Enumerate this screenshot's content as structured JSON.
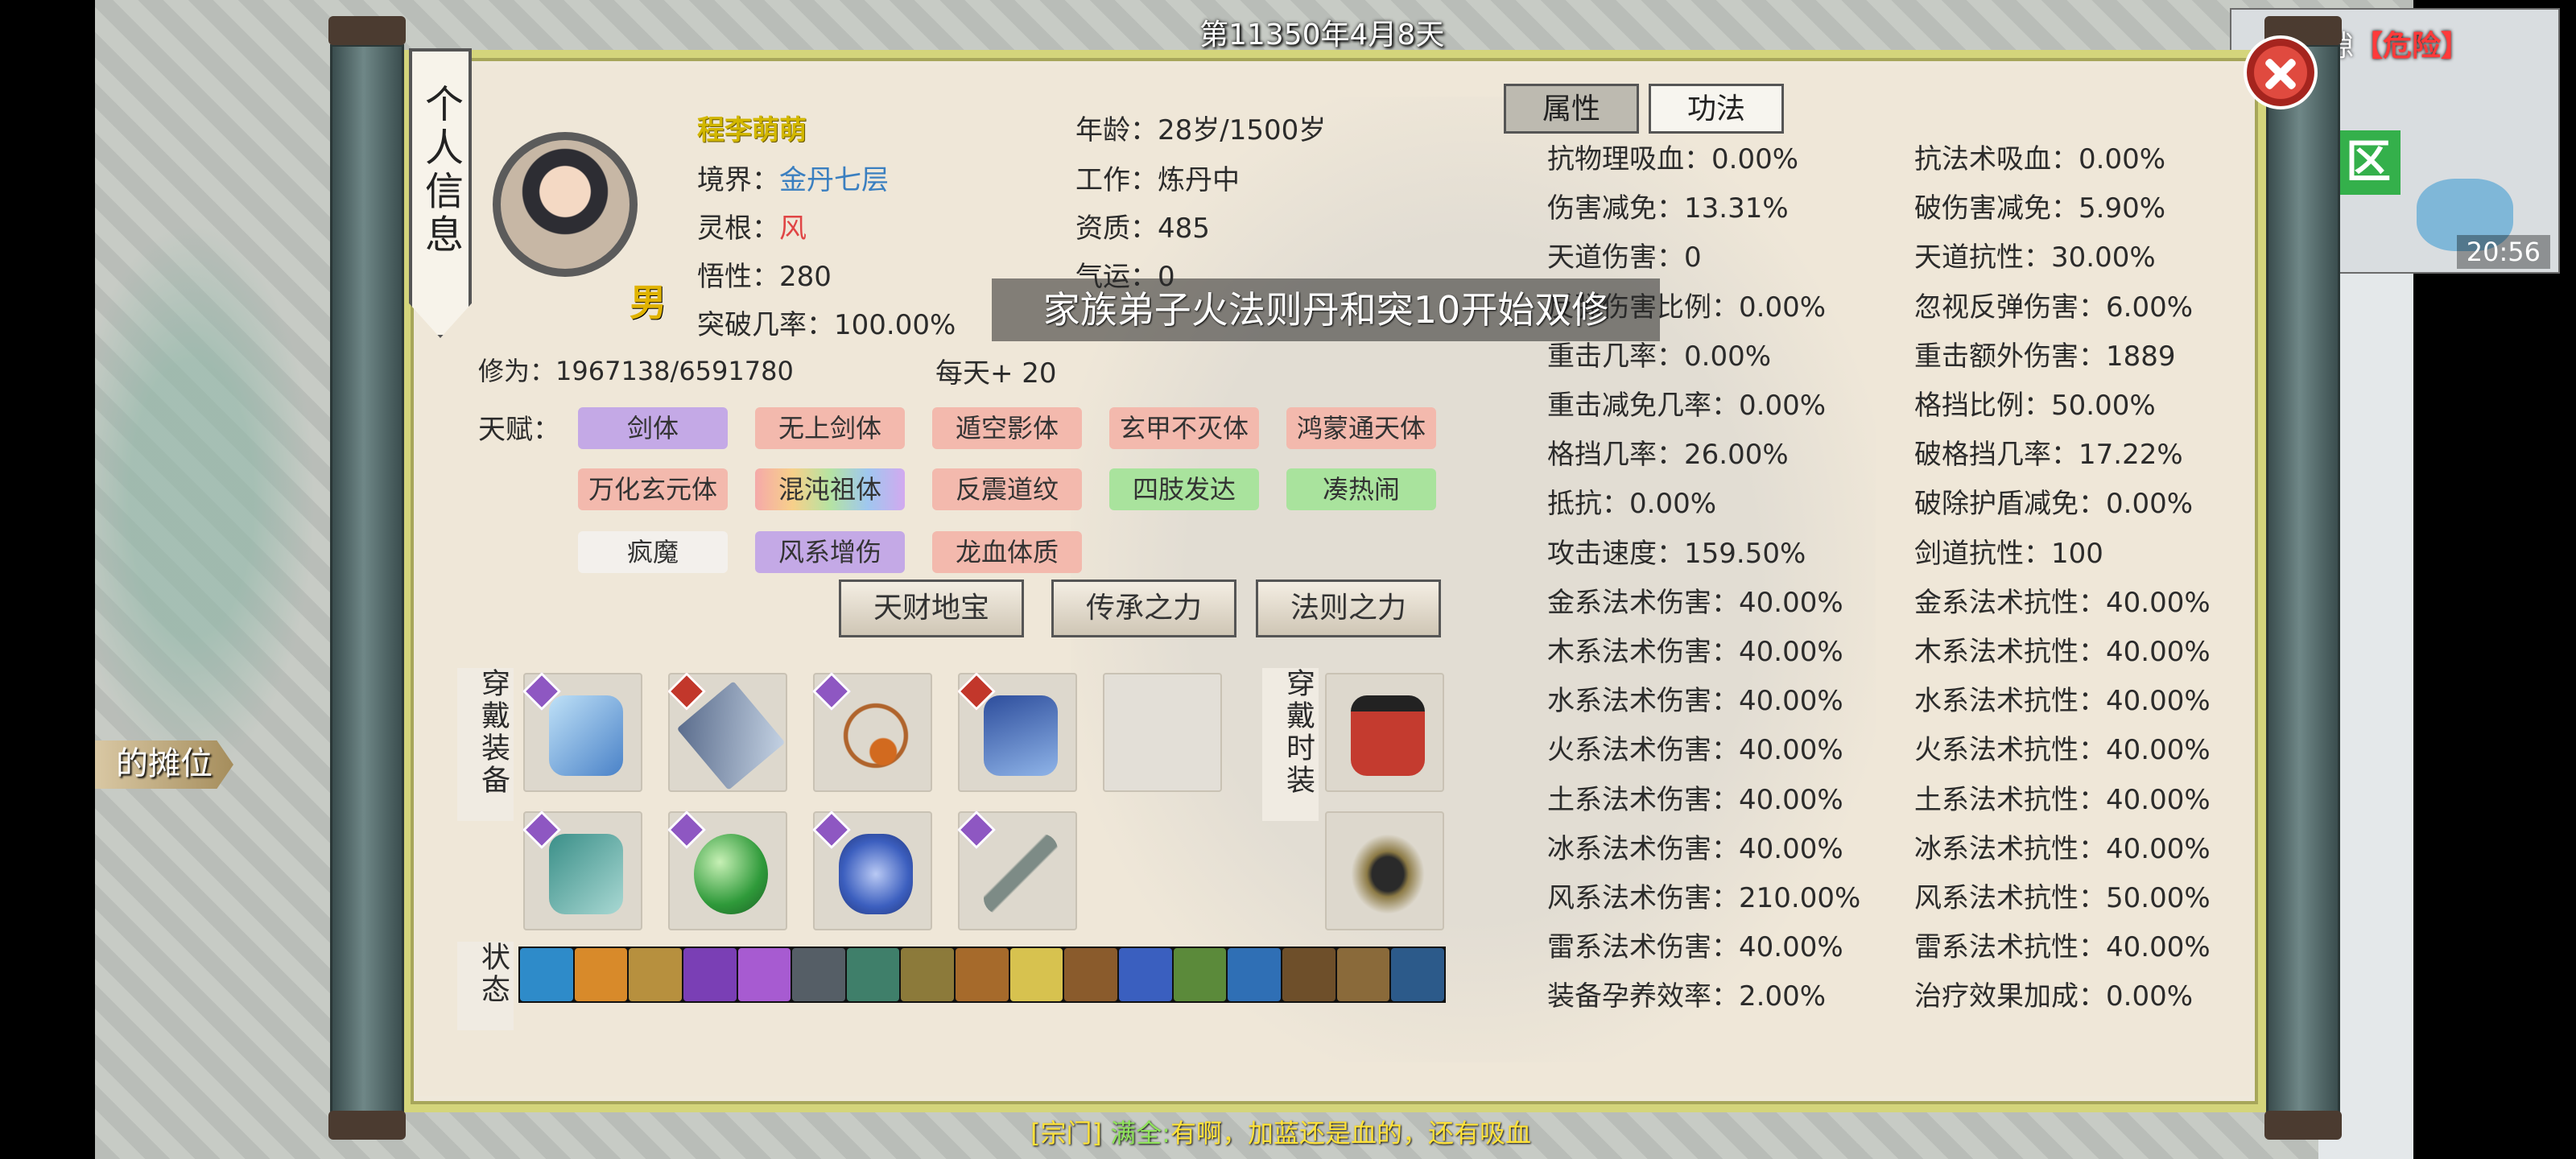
{
  "hud": {
    "date": "第11350年4月8天",
    "rift_label": "裂隙",
    "rift_danger": "【危险】",
    "minimap_zone": "区",
    "clock": "20:56",
    "stall_label": "的摊位",
    "chat_channel": "[宗门]",
    "chat_speaker": "满全:",
    "chat_text": "有啊，加蓝还是血的，还有吸血"
  },
  "subtitle": "家族弟子火法则丹和突10开始双修",
  "panel": {
    "banner": "个人信息",
    "gender": "男",
    "tabs": [
      "属性",
      "功法"
    ],
    "name": "程李萌萌",
    "left_info": [
      {
        "label": "境界：",
        "value": "金丹七层"
      },
      {
        "label": "灵根：",
        "value": "风"
      },
      {
        "label": "悟性：",
        "value": "280"
      },
      {
        "label": "突破几率：",
        "value": "100.00%"
      }
    ],
    "right_info": [
      {
        "label": "年龄：",
        "value": "28岁/1500岁"
      },
      {
        "label": "工作：",
        "value": "炼丹中"
      },
      {
        "label": "资质：",
        "value": "485"
      },
      {
        "label": "气运：",
        "value": "0"
      }
    ],
    "cultivation_label": "修为：",
    "cultivation_value": "1967138/6591780",
    "daily": "每天+ 20",
    "talent_label": "天赋：",
    "talents": [
      "剑体",
      "无上剑体",
      "遁空影体",
      "玄甲不灭体",
      "鸿蒙通天体",
      "万化玄元体",
      "混沌祖体",
      "反震道纹",
      "四肢发达",
      "凑热闹",
      "疯魔",
      "风系增伤",
      "龙血体质"
    ],
    "buttons": [
      "天财地宝",
      "传承之力",
      "法则之力"
    ],
    "equip_label": "穿戴装备",
    "fashion_label": "穿戴时装",
    "status_label": "状态"
  },
  "stats_left": [
    "抗物理吸血：0.00%",
    "伤害减免：13.31%",
    "天道伤害：0",
    "反弹伤害比例：0.00%",
    "重击几率：0.00%",
    "重击减免几率：0.00%",
    "格挡几率：26.00%",
    "抵抗：0.00%",
    "攻击速度：159.50%",
    "金系法术伤害：40.00%",
    "木系法术伤害：40.00%",
    "水系法术伤害：40.00%",
    "火系法术伤害：40.00%",
    "土系法术伤害：40.00%",
    "冰系法术伤害：40.00%",
    "风系法术伤害：210.00%",
    "雷系法术伤害：40.00%",
    "装备孕养效率：2.00%"
  ],
  "stats_right": [
    "抗法术吸血：0.00%",
    "破伤害减免：5.90%",
    "天道抗性：30.00%",
    "忽视反弹伤害：6.00%",
    "重击额外伤害：1889",
    "格挡比例：50.00%",
    "破格挡几率：17.22%",
    "破除护盾减免：0.00%",
    "剑道抗性：100",
    "金系法术抗性：40.00%",
    "木系法术抗性：40.00%",
    "水系法术抗性：40.00%",
    "火系法术抗性：40.00%",
    "土系法术抗性：40.00%",
    "冰系法术抗性：40.00%",
    "风系法术抗性：50.00%",
    "雷系法术抗性：40.00%",
    "治疗效果加成：0.00%"
  ],
  "status_icons": [
    "status-1",
    "status-2",
    "status-3",
    "status-4",
    "status-5",
    "status-6",
    "status-7",
    "status-8",
    "status-9",
    "status-10",
    "status-11",
    "status-12",
    "status-13",
    "status-14",
    "status-15",
    "status-16",
    "status-17"
  ],
  "colors": {
    "name": "#d2b700",
    "realm": "#3a7fc0",
    "root": "#e04545",
    "danger": "#ff3a3a"
  }
}
